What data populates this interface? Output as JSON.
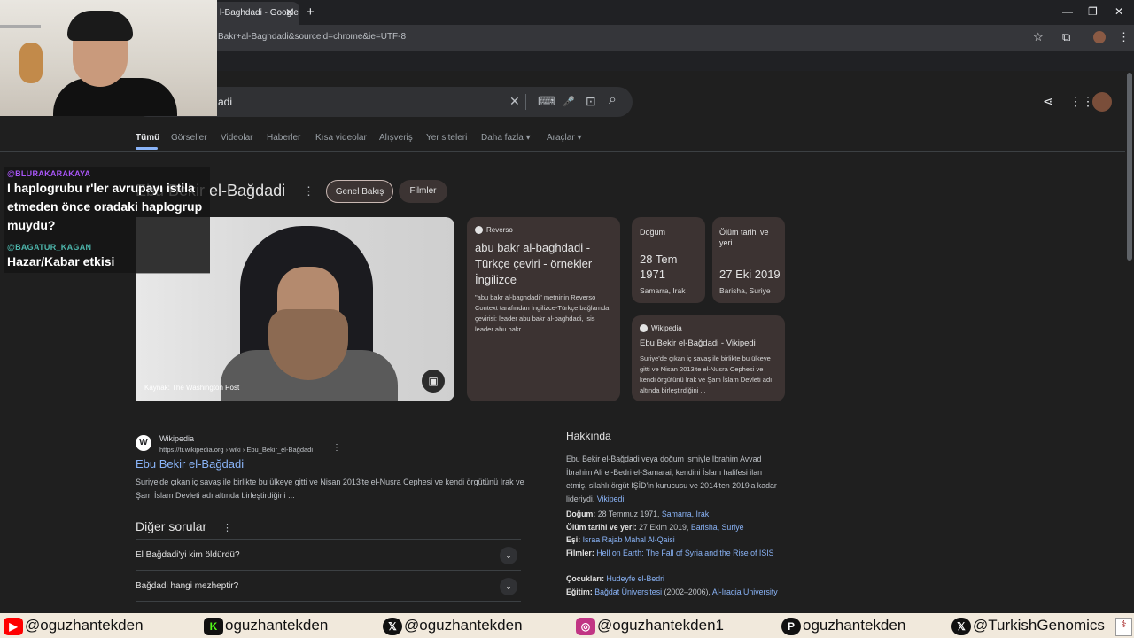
{
  "browser": {
    "tab_title": "l-Baghdadi - Google",
    "tab_close": "✕",
    "new_tab": "+",
    "url": "Bakr+al-Baghdadi&sourceid=chrome&ie=UTF-8",
    "win_min": "—",
    "win_max": "❐",
    "win_close": "✕"
  },
  "search": {
    "query": "adi",
    "clear": "✕",
    "keyboard": "⌨",
    "mic": "🎤",
    "lens": "⊡",
    "search": "⌕"
  },
  "nav": [
    "Tümü",
    "Görseller",
    "Videolar",
    "Haberler",
    "Kısa videolar",
    "Alışveriş",
    "Yer siteleri",
    "Daha fazla ▾",
    "Araçlar ▾"
  ],
  "chat": [
    {
      "user": "@BLURAKARAKAYA",
      "message": "I haplogrubu r'ler avrupayı istila etmeden önce oradaki haplogrup muydu?"
    },
    {
      "user": "@BAGATUR_KAGAN",
      "message": "Hazar/Kabar etkisi"
    }
  ],
  "panel": {
    "title": "Ebu Bekir el-Bağdadi",
    "more": "⋮",
    "pills": [
      "Genel Bakış",
      "Filmler"
    ],
    "photo_source": "Kaynak: The Washington Post",
    "reverso": {
      "source": "Reverso",
      "title": "abu bakr al-baghdadi - Türkçe çeviri - örnekler İngilizce",
      "text": "\"abu bakr al-baghdadi\" metninin Reverso Context tarafından İngilizce-Türkçe bağlamda çevirisi: leader abu bakr al-baghdadi, isis leader abu bakr ..."
    },
    "birth": {
      "label": "Doğum",
      "date": "28 Tem 1971",
      "place": "Samarra, Irak"
    },
    "death": {
      "label": "Ölüm tarihi ve yeri",
      "date": "27 Eki 2019",
      "place": "Barisha, Suriye"
    },
    "wiki_card": {
      "source": "Wikipedia",
      "title": "Ebu Bekir el-Bağdadi - Vikipedi",
      "text": "Suriye'de çıkan iç savaş ile birlikte bu ülkeye gitti ve Nisan 2013'te el-Nusra Cephesi ve kendi örgütünü Irak ve Şam İslam Devleti adı altında birleştirdiğini ..."
    }
  },
  "result": {
    "logo": "W",
    "site": "Wikipedia",
    "url": "https://tr.wikipedia.org › wiki › Ebu_Bekir_el-Bağdadi",
    "title": "Ebu Bekir el-Bağdadi",
    "snippet": "Suriye'de çıkan iç savaş ile birlikte bu ülkeye gitti ve Nisan 2013'te el-Nusra Cephesi ve kendi örgütünü Irak ve Şam İslam Devleti adı altında birleştirdiğini ..."
  },
  "other_questions": {
    "title": "Diğer sorular",
    "items": [
      "El Bağdadi'yi kim öldürdü?",
      "Bağdadi hangi mezheptir?"
    ],
    "chevron": "⌄"
  },
  "about": {
    "title": "Hakkında",
    "desc": "Ebu Bekir el-Bağdadi veya doğum ismiyle İbrahim Avvad İbrahim Ali el-Bedri el-Samarai, kendini İslam halifesi ilan etmiş, silahlı örgüt IŞİD'in kurucusu ve 2014'ten 2019'a kadar lideriydi.",
    "desc_link": "Vikipedi",
    "birth_label": "Doğum:",
    "birth_value": "28 Temmuz 1971,",
    "birth_link": "Samarra, Irak",
    "death_label": "Ölüm tarihi ve yeri:",
    "death_value": "27 Ekim 2019,",
    "death_link": "Barisha, Suriye",
    "spouse_label": "Eşi:",
    "spouse_link": "Israa Rajab Mahal Al-Qaisi",
    "films_label": "Filmler:",
    "films_link": "Hell on Earth: The Fall of Syria and the Rise of ISIS",
    "children_label": "Çocukları:",
    "children_link": "Hudeyfe el-Bedri",
    "edu_label": "Eğitim:",
    "edu_link1": "Bağdat Üniversitesi",
    "edu_years": "(2002–2006),",
    "edu_link2": "Al-Iraqia University"
  },
  "banner": [
    {
      "icon": "youtube-icon",
      "text": "@oguzhantekden"
    },
    {
      "icon": "kick-icon",
      "text": "oguzhantekden"
    },
    {
      "icon": "x-icon",
      "text": "@oguzhantekden"
    },
    {
      "icon": "instagram-icon",
      "text": "@oguzhantekden1"
    },
    {
      "icon": "patreon-icon",
      "text": "oguzhantekden"
    },
    {
      "icon": "x-icon",
      "text": "@TurkishGenomics"
    }
  ],
  "colors": {
    "link": "#8ab4f8",
    "card": "#3c3332",
    "background": "#1f1f1f"
  }
}
